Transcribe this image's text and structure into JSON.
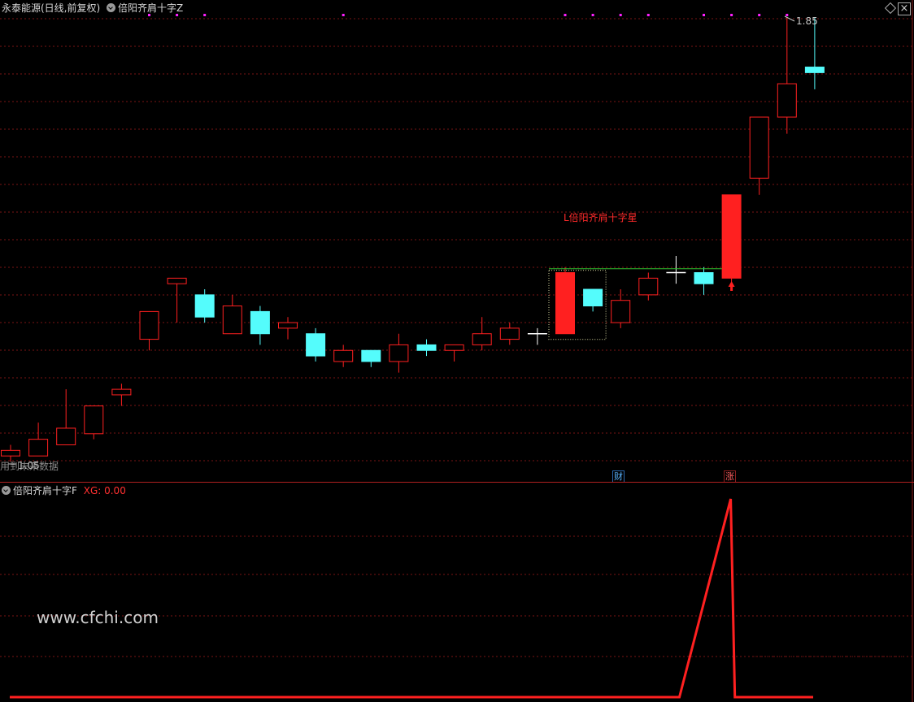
{
  "header": {
    "stock_title": "永泰能源(日线,前复权)",
    "indicator_main": "倍阳齐肩十字Z"
  },
  "main_chart": {
    "candles": [
      {
        "o": 1.06,
        "c": 1.07,
        "h": 1.08,
        "l": 1.05
      },
      {
        "o": 1.06,
        "c": 1.09,
        "h": 1.12,
        "l": 1.06
      },
      {
        "o": 1.08,
        "c": 1.11,
        "h": 1.18,
        "l": 1.08
      },
      {
        "o": 1.1,
        "c": 1.15,
        "h": 1.15,
        "l": 1.09
      },
      {
        "o": 1.17,
        "c": 1.18,
        "h": 1.19,
        "l": 1.15
      },
      {
        "o": 1.27,
        "c": 1.32,
        "h": 1.32,
        "l": 1.25
      },
      {
        "o": 1.37,
        "c": 1.38,
        "h": 1.38,
        "l": 1.3
      },
      {
        "o": 1.35,
        "c": 1.31,
        "h": 1.36,
        "l": 1.3
      },
      {
        "o": 1.28,
        "c": 1.33,
        "h": 1.35,
        "l": 1.28
      },
      {
        "o": 1.32,
        "c": 1.28,
        "h": 1.33,
        "l": 1.26
      },
      {
        "o": 1.29,
        "c": 1.3,
        "h": 1.31,
        "l": 1.27
      },
      {
        "o": 1.28,
        "c": 1.24,
        "h": 1.29,
        "l": 1.23
      },
      {
        "o": 1.23,
        "c": 1.25,
        "h": 1.26,
        "l": 1.22
      },
      {
        "o": 1.25,
        "c": 1.23,
        "h": 1.25,
        "l": 1.22
      },
      {
        "o": 1.23,
        "c": 1.26,
        "h": 1.28,
        "l": 1.21
      },
      {
        "o": 1.26,
        "c": 1.25,
        "h": 1.27,
        "l": 1.24
      },
      {
        "o": 1.25,
        "c": 1.26,
        "h": 1.26,
        "l": 1.23
      },
      {
        "o": 1.26,
        "c": 1.28,
        "h": 1.31,
        "l": 1.25
      },
      {
        "o": 1.27,
        "c": 1.29,
        "h": 1.3,
        "l": 1.26
      },
      {
        "o": 1.28,
        "c": 1.28,
        "h": 1.29,
        "l": 1.26
      },
      {
        "o": 1.28,
        "c": 1.39,
        "h": 1.4,
        "l": 1.28
      },
      {
        "o": 1.36,
        "c": 1.33,
        "h": 1.36,
        "l": 1.32
      },
      {
        "o": 1.3,
        "c": 1.34,
        "h": 1.36,
        "l": 1.29
      },
      {
        "o": 1.35,
        "c": 1.38,
        "h": 1.39,
        "l": 1.34
      },
      {
        "o": 1.39,
        "c": 1.39,
        "h": 1.42,
        "l": 1.37
      },
      {
        "o": 1.39,
        "c": 1.37,
        "h": 1.4,
        "l": 1.35
      },
      {
        "o": 1.38,
        "c": 1.53,
        "h": 1.53,
        "l": 1.37
      },
      {
        "o": 1.56,
        "c": 1.67,
        "h": 1.67,
        "l": 1.53
      },
      {
        "o": 1.67,
        "c": 1.73,
        "h": 1.85,
        "l": 1.64
      },
      {
        "o": 1.76,
        "c": 1.75,
        "h": 1.85,
        "l": 1.72
      }
    ],
    "max_label": "1.85",
    "min_label": "1.05",
    "watermark_text": "用到未来数据",
    "annotation": "L倍阳齐肩十字星",
    "tag_cai": "财",
    "tag_zhang": "涨",
    "up_color": "#ff2020",
    "down_color": "#54fcfc"
  },
  "sub_chart": {
    "indicator_name": "倍阳齐肩十字F",
    "xg_label": "XG: 0.00",
    "values": [
      0,
      0,
      0,
      0,
      0,
      0,
      0,
      0,
      0,
      0,
      0,
      0,
      0,
      0,
      0,
      0,
      0,
      0,
      0,
      0,
      0,
      0,
      0,
      0,
      0,
      0,
      1,
      0,
      0,
      0
    ],
    "line_color": "#ff2020"
  },
  "site_watermark": "www.cfchi.com"
}
